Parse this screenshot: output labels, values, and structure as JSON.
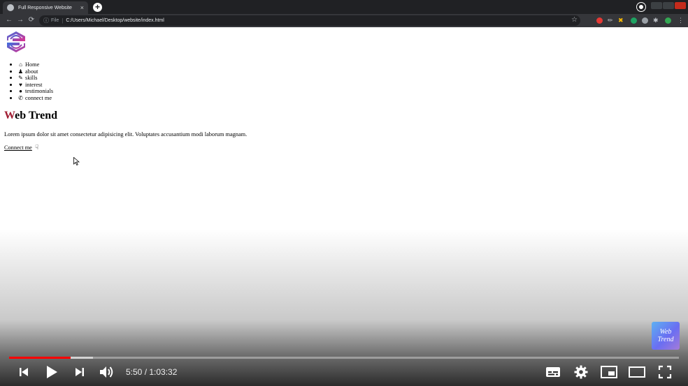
{
  "browser": {
    "tab_title": "Full Responsive Website",
    "tab_close": "×",
    "new_tab": "+",
    "file_label": "File",
    "separator": "|",
    "url": "C:/Users/Michael/Desktop/website/index.html",
    "nav_icons": [
      "arrow-left-icon",
      "arrow-right-icon",
      "reload-icon"
    ]
  },
  "page": {
    "nav": [
      {
        "icon": "home-icon",
        "glyph": "⌂",
        "label": "Home"
      },
      {
        "icon": "user-icon",
        "glyph": "♟",
        "label": "about"
      },
      {
        "icon": "wrench-icon",
        "glyph": "✎",
        "label": "skills"
      },
      {
        "icon": "heart-icon",
        "glyph": "♥",
        "label": "interest"
      },
      {
        "icon": "comment-icon",
        "glyph": "●",
        "label": "testimonials"
      },
      {
        "icon": "phone-icon",
        "glyph": "✆",
        "label": "connect me"
      }
    ],
    "heading_first": "W",
    "heading_rest": "eb Trend",
    "lead": "Lorem ipsum dolor sit amet consectetur adipisicing elit. Voluptates accusantium modi laborum magnam.",
    "connect_label": "Connect me",
    "connect_icon_glyph": "☟"
  },
  "video": {
    "current_time": "5:50",
    "duration": "1:03:32",
    "time_text": "5:50 / 1:03:32",
    "played_fraction": 0.092,
    "buffered_fraction": 0.125,
    "watermark_line1": "Web",
    "watermark_line2": "Trend"
  },
  "colors": {
    "accent": "#a11d33",
    "progress": "#ff0000",
    "chrome_dark": "#202124",
    "chrome_mid": "#35363a"
  }
}
